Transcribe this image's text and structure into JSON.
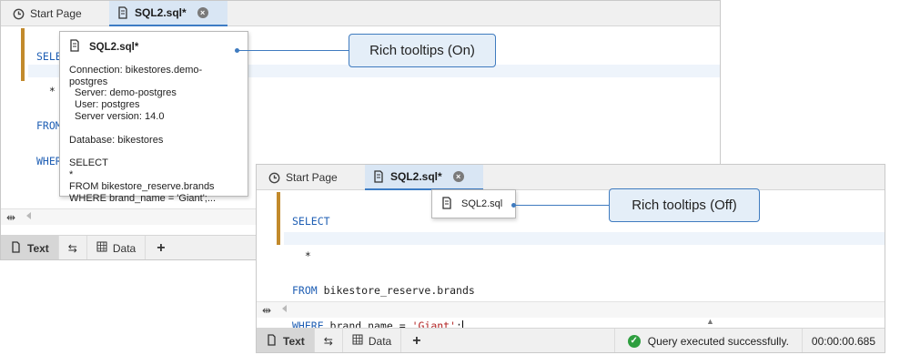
{
  "window_back": {
    "tabs": [
      {
        "label": "Start Page",
        "icon": "start-page-icon"
      },
      {
        "label": "SQL2.sql*",
        "icon": "sql-file-icon",
        "close_icon": "close-icon"
      }
    ],
    "code_lines": [
      "SELECT",
      "  *",
      "FROM",
      "WHERE"
    ],
    "bottom": {
      "text_label": "Text",
      "data_label": "Data",
      "add_label": "+"
    }
  },
  "rich_tooltip": {
    "title": "SQL2.sql*",
    "connection": "Connection: bikestores.demo-postgres",
    "server": "Server: demo-postgres",
    "user": "User: postgres",
    "server_version": "Server version: 14.0",
    "database": "Database: bikestores",
    "query_lines": [
      "SELECT",
      "*",
      "FROM bikestore_reserve.brands",
      "WHERE brand_name = 'Giant';..."
    ]
  },
  "callouts": {
    "on": "Rich tooltips (On)",
    "off": "Rich tooltips (Off)"
  },
  "window_front": {
    "tabs": [
      {
        "label": "Start Page",
        "icon": "start-page-icon"
      },
      {
        "label": "SQL2.sql*",
        "icon": "sql-file-icon",
        "close_icon": "close-icon"
      }
    ],
    "code": {
      "select": "SELECT",
      "star": "  *",
      "from_kw": "FROM",
      "from_rest": " bikestore_reserve.brands",
      "where_kw": "WHERE",
      "where_mid": " brand_name = ",
      "where_str": "'Giant'",
      "where_end": ";"
    },
    "bottom": {
      "text_label": "Text",
      "data_label": "Data",
      "add_label": "+"
    },
    "status": {
      "message": "Query executed successfully.",
      "time": "00:00:00.685"
    }
  },
  "plain_tooltip": {
    "title": "SQL2.sql"
  },
  "colors": {
    "accent": "#3f7bbf",
    "keyword": "#1f5fb4",
    "string": "#b22222",
    "gutter_mark": "#c28a2c",
    "success": "#2e9e3f"
  }
}
